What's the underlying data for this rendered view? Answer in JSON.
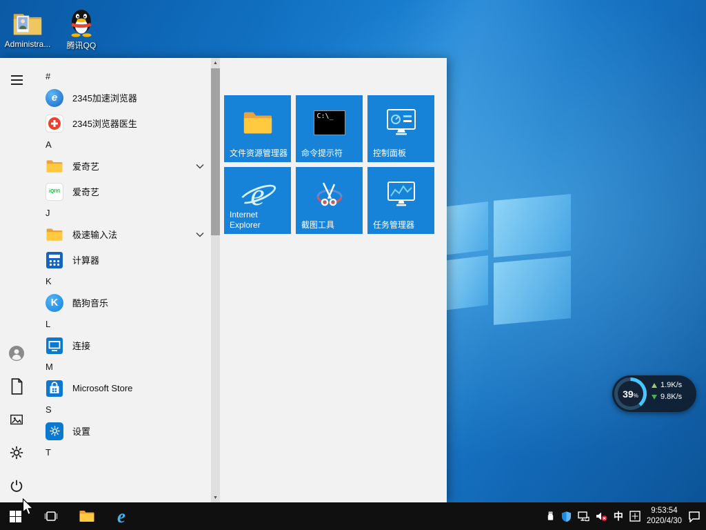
{
  "colors": {
    "accent_tile": "#1683d8",
    "menu_bg": "#f2f2f2",
    "taskbar_bg": "#101010",
    "gauge_ring": "#45c8ff",
    "up_arrow": "#9ccc65",
    "down_arrow": "#4caf50"
  },
  "desktop": {
    "icons": [
      {
        "label": "Administra..."
      },
      {
        "label": "腾讯QQ"
      }
    ]
  },
  "start_menu": {
    "app_list": [
      {
        "kind": "header",
        "label": "#"
      },
      {
        "kind": "app",
        "label": "2345加速浏览器"
      },
      {
        "kind": "app",
        "label": "2345浏览器医生"
      },
      {
        "kind": "header",
        "label": "A"
      },
      {
        "kind": "folder",
        "label": "爱奇艺"
      },
      {
        "kind": "app",
        "label": "爱奇艺"
      },
      {
        "kind": "header",
        "label": "J"
      },
      {
        "kind": "folder",
        "label": "极速输入法"
      },
      {
        "kind": "app",
        "label": "计算器"
      },
      {
        "kind": "header",
        "label": "K"
      },
      {
        "kind": "app",
        "label": "酷狗音乐"
      },
      {
        "kind": "header",
        "label": "L"
      },
      {
        "kind": "app",
        "label": "连接"
      },
      {
        "kind": "header",
        "label": "M"
      },
      {
        "kind": "app",
        "label": "Microsoft Store"
      },
      {
        "kind": "header",
        "label": "S"
      },
      {
        "kind": "app",
        "label": "设置"
      },
      {
        "kind": "header",
        "label": "T"
      }
    ],
    "tiles": [
      {
        "label": "文件资源管理器"
      },
      {
        "label": "命令提示符"
      },
      {
        "label": "控制面板"
      },
      {
        "label": "Internet Explorer"
      },
      {
        "label": "截图工具"
      },
      {
        "label": "任务管理器"
      }
    ]
  },
  "icon_glyphs": {
    "browser_2345": "e",
    "iqiyi": "iQIYI",
    "kugou": "K",
    "cmd": "C:\\_",
    "ie": "e",
    "edge_taskbar": "e"
  },
  "net_widget": {
    "percent": "39",
    "percent_unit": "%",
    "up_speed": "1.9K/s",
    "down_speed": "9.8K/s"
  },
  "taskbar": {
    "ime_lang": "中",
    "time": "9:53:54",
    "date": "2020/4/30"
  }
}
